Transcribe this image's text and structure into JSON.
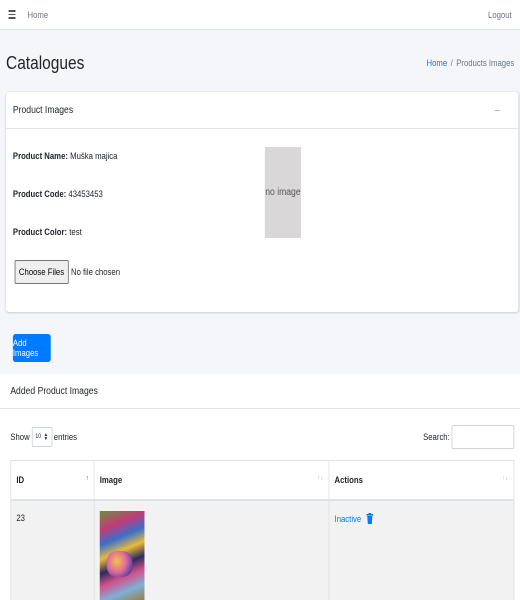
{
  "topbar": {
    "home_label": "Home",
    "logout_label": "Logout"
  },
  "page": {
    "title": "Catalogues"
  },
  "breadcrumb": {
    "home": "Home",
    "separator": "/",
    "current": "Products Images"
  },
  "product_card": {
    "header": "Product Images",
    "collapse_symbol": "–",
    "name_label": "Product Name:",
    "name_value": "Muška majica",
    "code_label": "Product Code:",
    "code_value": "43453453",
    "color_label": "Product Color:",
    "color_value": "test",
    "no_image_text": "no image",
    "file_button": "Choose Files",
    "file_status": "No file chosen"
  },
  "add_button": "Add Images",
  "images_card": {
    "header": "Added Product Images",
    "show_label": "Show",
    "page_length": "10",
    "entries_label": "entries",
    "search_label": "Search:",
    "columns": [
      "ID",
      "Image",
      "Actions"
    ],
    "rows": [
      {
        "id": "23",
        "status": "Inactive"
      }
    ]
  },
  "colors": {
    "accent": "#007bff",
    "no_image_bg": "#d9d7d7"
  },
  "icons": {
    "menu": "hamburger-icon",
    "delete": "trash-icon",
    "sort": "sort-arrows-icon"
  }
}
